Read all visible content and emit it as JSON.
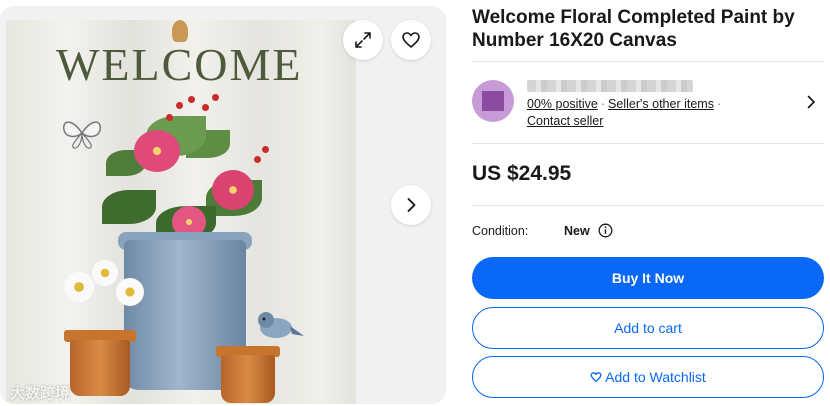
{
  "gallery": {
    "painting_text": "WELCOME",
    "watermark": "大数跨境",
    "icons": {
      "expand": "expand-icon",
      "watch": "heart-icon",
      "next": "chevron-right-icon"
    }
  },
  "listing": {
    "title": "Welcome Floral Completed Paint by Number 16X20 Canvas",
    "price": "US $24.95",
    "condition_label": "Condition:",
    "condition_value": "New"
  },
  "seller": {
    "positive": "00% positive",
    "other_items": "Seller's other items",
    "contact": "Contact seller",
    "separator": "·"
  },
  "actions": {
    "buy_now": "Buy It Now",
    "add_to_cart": "Add to cart",
    "add_to_watchlist": "Add to Watchlist"
  },
  "colors": {
    "primary": "#0968f6",
    "text": "#191919",
    "divider": "#e5e5e5"
  }
}
